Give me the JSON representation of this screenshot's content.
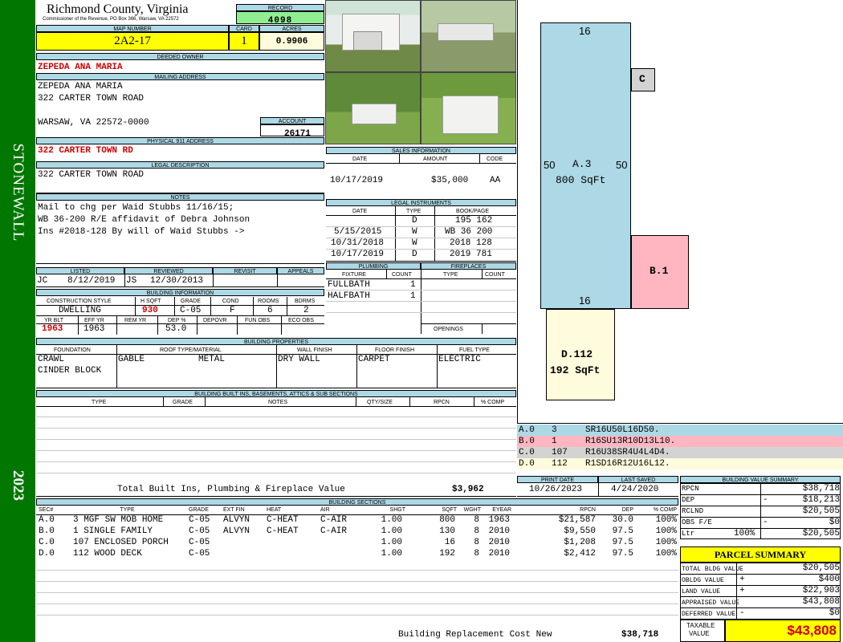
{
  "side": {
    "district": "STONEWALL",
    "year": "2023"
  },
  "header": {
    "county": "Richmond County, Virginia",
    "commissioner": "Commissioner of the Revenue, PO Box 366, Warsaw, VA 22572",
    "record_label": "RECORD",
    "record": "4098",
    "map_label": "MAP NUMBER",
    "map": "2A2-17",
    "card_label": "CARD",
    "card": "1",
    "acres_label": "ACRES",
    "acres": "0.9906"
  },
  "owner": {
    "deeded_label": "DEEDED OWNER",
    "deeded": "ZEPEDA ANA MARIA",
    "mailing_label": "MAILING ADDRESS",
    "mail1": "ZEPEDA ANA MARIA",
    "mail2": "322 CARTER TOWN ROAD",
    "mail3": "WARSAW, VA 22572-0000",
    "account_label": "ACCOUNT",
    "account": "26171",
    "physical_label": "PHYSICAL 911 ADDRESS",
    "physical": "322 CARTER TOWN RD"
  },
  "legal": {
    "label": "LEGAL DESCRIPTION",
    "text": "322 CARTER TOWN ROAD"
  },
  "notes": {
    "label": "NOTES",
    "lines": [
      "Mail to chg per Waid Stubbs 11/16/15;",
      "WB 36-200 R/E affidavit of Debra Johnson",
      "Ins #2018-128 By will of Waid Stubbs ->"
    ]
  },
  "sales": {
    "label": "SALES INFORMATION",
    "h_date": "DATE",
    "h_amount": "AMOUNT",
    "h_code": "CODE",
    "date": "10/17/2019",
    "amount": "$35,000",
    "code": "AA"
  },
  "instruments": {
    "label": "LEGAL INSTRUMENTS",
    "h_date": "DATE",
    "h_type": "TYPE",
    "h_book": "BOOK/PAGE",
    "rows": [
      {
        "date": "",
        "type": "D",
        "book": "195 162"
      },
      {
        "date": "5/15/2015",
        "type": "W",
        "book": "WB 36 200"
      },
      {
        "date": "10/31/2018",
        "type": "W",
        "book": "2018 128"
      },
      {
        "date": "10/17/2019",
        "type": "D",
        "book": "2019 781"
      }
    ]
  },
  "review": {
    "h_listed": "LISTED",
    "h_reviewed": "REVIEWED",
    "h_revisit": "REVISIT",
    "h_appeals": "APPEALS",
    "listed_by": "JC",
    "listed": "8/12/2019",
    "reviewed_by": "JS",
    "reviewed": "12/30/2013"
  },
  "bldg": {
    "label": "BUILDING INFORMATION",
    "h_style": "CONSTRUCTION STYLE",
    "h_hsqft": "H SQFT",
    "h_grade": "GRADE",
    "h_cond": "COND",
    "h_rooms": "ROOMS",
    "h_bdrms": "BDRMS",
    "style": "DWELLING",
    "hsqft": "930",
    "grade": "C-05",
    "cond": "F",
    "rooms": "6",
    "bdrms": "2",
    "h_yrblt": "YR BLT",
    "h_effyr": "EFF YR",
    "h_remyr": "REM YR",
    "h_dep": "DEP %",
    "h_depovr": "DEPOVR",
    "h_funobs": "FUN OBS",
    "h_ecoobs": "ECO OBS",
    "yrblt": "1963",
    "effyr": "1963",
    "dep": "53.0"
  },
  "plumbing": {
    "label": "PLUMBING",
    "h_fixture": "FIXTURE",
    "h_count": "COUNT",
    "rows": [
      {
        "f": "FULLBATH",
        "c": "1"
      },
      {
        "f": "HALFBATH",
        "c": "1"
      }
    ]
  },
  "fireplaces": {
    "label": "FIREPLACES",
    "h_type": "TYPE",
    "h_count": "COUNT",
    "openings": "OPENINGS"
  },
  "props": {
    "label": "BUILDING PROPERTIES",
    "h_found": "FOUNDATION",
    "h_roof": "ROOF TYPE/MATERIAL",
    "h_wall": "WALL FINISH",
    "h_floor": "FLOOR FINISH",
    "h_fuel": "FUEL TYPE",
    "found1": "CRAWL",
    "found2": "CINDER BLOCK",
    "roof1": "GABLE",
    "roof2": "METAL",
    "wall": "DRY WALL",
    "floor": "CARPET",
    "fuel": "ELECTRIC"
  },
  "builtins": {
    "label": "BUILDING BUILT INS, BASEMENTS, ATTICS & SUB SECTIONS",
    "h_type": "TYPE",
    "h_grade": "GRADE",
    "h_notes": "NOTES",
    "h_qty": "QTY/SIZE",
    "h_rpcn": "RPCN",
    "h_comp": "% COMP",
    "total_label": "Total Built Ins, Plumbing & Fireplace Value",
    "total": "$3,962"
  },
  "dates": {
    "h_print": "PRINT DATE",
    "h_saved": "LAST SAVED",
    "print": "10/26/2023",
    "saved": "4/24/2020"
  },
  "sections": {
    "label": "BUILDING SECTIONS",
    "headers": [
      "SEC#",
      "TYPE",
      "GRADE",
      "EXT FIN",
      "HEAT",
      "AIR",
      "SHGT",
      "SQFT",
      "WGHT",
      "EYEAR",
      "RPCN",
      "DEP",
      "% COMP"
    ],
    "rows": [
      {
        "sec": "A.0",
        "type": "3 MGF SW MOB HOME",
        "grade": "C-05",
        "ext": "ALVYN",
        "heat": "C-HEAT",
        "air": "C-AIR",
        "shgt": "1.00",
        "sqft": "800",
        "wght": "8",
        "eyear": "1963",
        "rpcn": "$21,587",
        "dep": "30.0",
        "comp": "100%"
      },
      {
        "sec": "B.0",
        "type": "1 SINGLE FAMILY",
        "grade": "C-05",
        "ext": "ALVYN",
        "heat": "C-HEAT",
        "air": "C-AIR",
        "shgt": "1.00",
        "sqft": "130",
        "wght": "8",
        "eyear": "2010",
        "rpcn": "$9,550",
        "dep": "97.5",
        "comp": "100%"
      },
      {
        "sec": "C.0",
        "type": "107 ENCLOSED PORCH",
        "grade": "C-05",
        "ext": "",
        "heat": "",
        "air": "",
        "shgt": "1.00",
        "sqft": "16",
        "wght": "8",
        "eyear": "2010",
        "rpcn": "$1,208",
        "dep": "97.5",
        "comp": "100%"
      },
      {
        "sec": "D.0",
        "type": "112 WOOD DECK",
        "grade": "C-05",
        "ext": "",
        "heat": "",
        "air": "",
        "shgt": "1.00",
        "sqft": "192",
        "wght": "8",
        "eyear": "2010",
        "rpcn": "$2,412",
        "dep": "97.5",
        "comp": "100%"
      }
    ],
    "replacement_label": "Building Replacement Cost New",
    "replacement": "$38,718"
  },
  "sketch": {
    "a_top": "16",
    "a_left": "50",
    "a_right": "50",
    "a_label": "A.3",
    "a_area": "800 SqFt",
    "a_bottom": "16",
    "c": "C",
    "b": "B.1",
    "d_label": "D.112",
    "d_area": "192 SqFt",
    "colors": {
      "a": "#add8e6",
      "b": "#ffb6c1",
      "c": "#d3d3d3",
      "d": "#fffbdc"
    }
  },
  "legend": [
    {
      "code": "A.0",
      "num": "3",
      "path": "SR16U50L16D50."
    },
    {
      "code": "B.0",
      "num": "1",
      "path": "R16SU13R10D13L10."
    },
    {
      "code": "C.0",
      "num": "107",
      "path": "R16U38SR4U4L4D4."
    },
    {
      "code": "D.0",
      "num": "112",
      "path": "R1SD16R12U16L12."
    }
  ],
  "bvs": {
    "label": "BUILDING VALUE SUMMARY",
    "rpcn_l": "RPCN",
    "rpcn": "$38,718",
    "dep_l": "DEP",
    "dep_s": "-",
    "dep": "$18,213",
    "rclnd_l": "RCLND",
    "rclnd": "$20,505",
    "obs_l": "OBS F/E",
    "obs_s": "-",
    "obs": "$0",
    "ltr_l": "Ltr",
    "ltr_p": "100%",
    "ltr": "$20,505"
  },
  "parcel": {
    "label": "PARCEL SUMMARY",
    "tbv_l": "TOTAL BLDG VALUE",
    "tbv": "$20,505",
    "obldg_l": "OBLDG VALUE",
    "obldg_s": "+",
    "obldg": "$400",
    "land_l": "LAND VALUE",
    "land_s": "+",
    "land": "$22,903",
    "appr_l": "APPRAISED VALUE",
    "appr": "$43,808",
    "def_l": "DEFERRED VALUE",
    "def_s": "-",
    "def": "$0",
    "tax_l1": "TAXABLE",
    "tax_l2": "VALUE",
    "tax": "$43,808"
  }
}
